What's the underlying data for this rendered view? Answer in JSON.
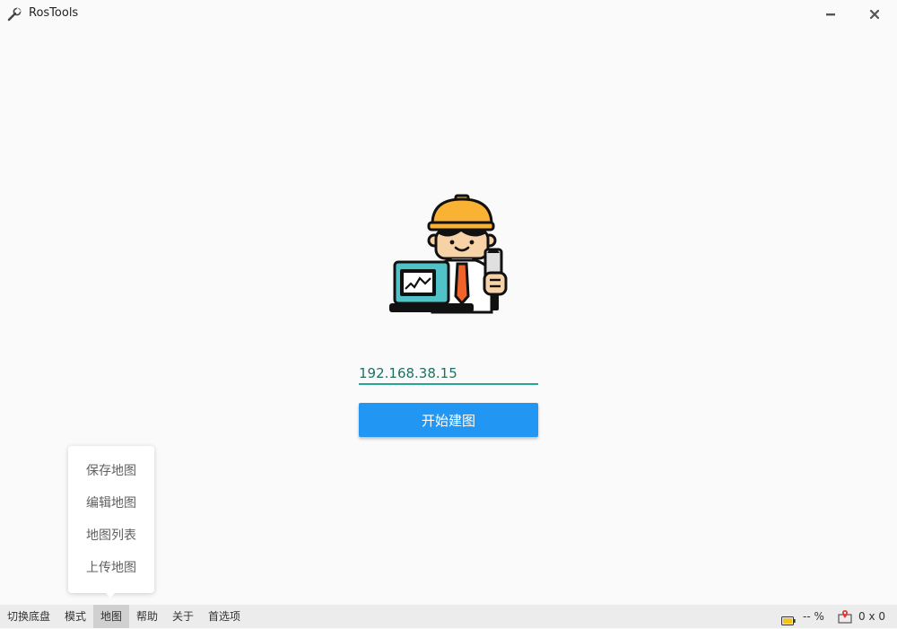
{
  "window": {
    "title": "RosTools",
    "app_icon": "wrench-icon",
    "minimize_icon": "minimize-icon",
    "close_icon": "close-icon"
  },
  "main": {
    "illustration": "engineer-with-laptop-illustration",
    "ip_input": {
      "value": "192.168.38.15",
      "underline_color": "#26a69a"
    },
    "start_button": {
      "label": "开始建图",
      "color": "#2196f3"
    }
  },
  "map_menu": {
    "items": [
      {
        "label": "保存地图"
      },
      {
        "label": "编辑地图"
      },
      {
        "label": "地图列表"
      },
      {
        "label": "上传地图"
      }
    ]
  },
  "bottom_menu": {
    "items": [
      {
        "label": "切换底盘"
      },
      {
        "label": "模式"
      },
      {
        "label": "地图",
        "active": true
      },
      {
        "label": "帮助"
      },
      {
        "label": "关于"
      },
      {
        "label": "首选项"
      }
    ]
  },
  "status": {
    "battery_icon": "battery-icon",
    "battery_text": "-- %",
    "location_icon": "map-pin-icon",
    "position_text": "0 x 0"
  }
}
